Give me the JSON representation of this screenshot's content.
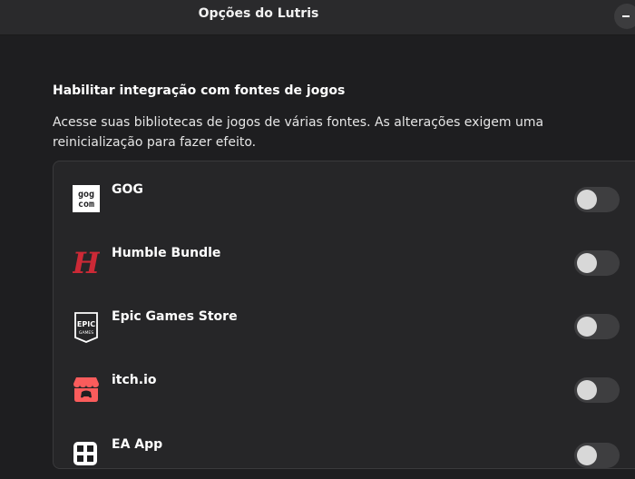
{
  "window": {
    "title": "Opções do Lutris"
  },
  "section": {
    "heading": "Habilitar integração com fontes de jogos",
    "description": "Acesse suas bibliotecas de jogos de várias fontes. As alterações exigem uma reinicialização para fazer efeito."
  },
  "sources": [
    {
      "label": "GOG",
      "icon": "gog-icon",
      "enabled": false
    },
    {
      "label": "Humble Bundle",
      "icon": "humble-bundle-icon",
      "enabled": false
    },
    {
      "label": "Epic Games Store",
      "icon": "epic-games-icon",
      "enabled": false
    },
    {
      "label": "itch.io",
      "icon": "itchio-icon",
      "enabled": false
    },
    {
      "label": "EA App",
      "icon": "ea-app-icon",
      "enabled": false
    }
  ],
  "colors": {
    "background": "#1e1e20",
    "titlebar": "#2a2a2c",
    "list_background": "#262628",
    "humble_red": "#cc2936",
    "itch_red": "#fa5c5c"
  }
}
